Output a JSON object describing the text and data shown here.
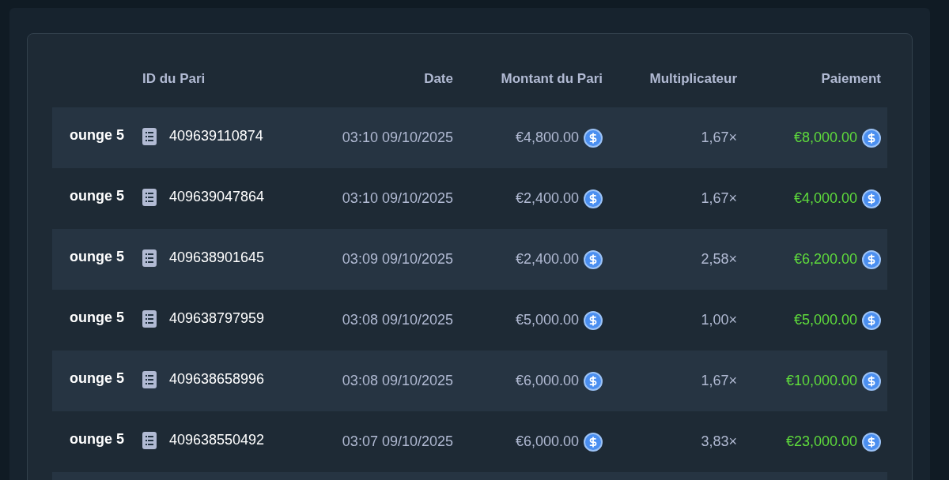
{
  "table": {
    "columns": [
      "ID du Pari",
      "Date",
      "Montant du Pari",
      "Multiplicateur",
      "Paiement"
    ],
    "rows": [
      {
        "game": "ounge 5",
        "bet_id": "409639110874",
        "date": "03:10 09/10/2025",
        "amount": "€4,800.00",
        "multiplier": "1,67×",
        "payout": "€8,000.00"
      },
      {
        "game": "ounge 5",
        "bet_id": "409639047864",
        "date": "03:10 09/10/2025",
        "amount": "€2,400.00",
        "multiplier": "1,67×",
        "payout": "€4,000.00"
      },
      {
        "game": "ounge 5",
        "bet_id": "409638901645",
        "date": "03:09 09/10/2025",
        "amount": "€2,400.00",
        "multiplier": "2,58×",
        "payout": "€6,200.00"
      },
      {
        "game": "ounge 5",
        "bet_id": "409638797959",
        "date": "03:08 09/10/2025",
        "amount": "€5,000.00",
        "multiplier": "1,00×",
        "payout": "€5,000.00"
      },
      {
        "game": "ounge 5",
        "bet_id": "409638658996",
        "date": "03:08 09/10/2025",
        "amount": "€6,000.00",
        "multiplier": "1,67×",
        "payout": "€10,000.00"
      },
      {
        "game": "ounge 5",
        "bet_id": "409638550492",
        "date": "03:07 09/10/2025",
        "amount": "€6,000.00",
        "multiplier": "3,83×",
        "payout": "€23,000.00"
      }
    ]
  }
}
